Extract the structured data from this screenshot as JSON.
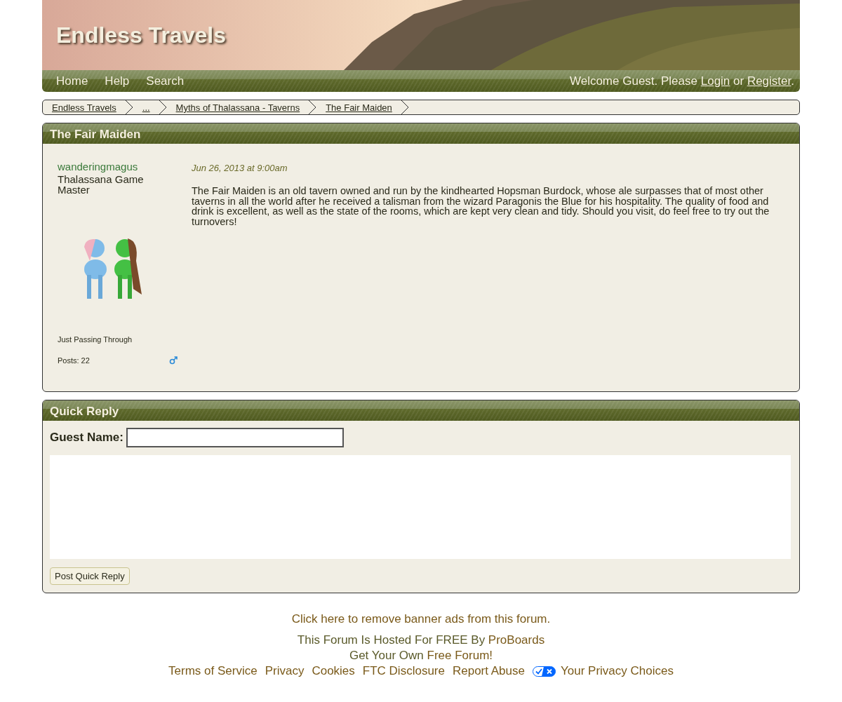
{
  "site": {
    "title": "Endless Travels"
  },
  "nav": {
    "items": [
      {
        "label": "Home"
      },
      {
        "label": "Help"
      },
      {
        "label": "Search"
      }
    ],
    "welcome": {
      "before": "Welcome Guest. Please ",
      "login": "Login",
      "middle": " or ",
      "register": "Register",
      "after": "."
    }
  },
  "breadcrumbs": [
    {
      "label": "Endless Travels"
    },
    {
      "label": "..."
    },
    {
      "label": "Myths of Thalassana - Taverns"
    },
    {
      "label": "The Fair Maiden"
    }
  ],
  "thread": {
    "title": "The Fair Maiden",
    "post": {
      "author": "wanderingmagus",
      "rank": "Thalassana Game Master",
      "status": "Just Passing Through",
      "posts": "Posts: 22",
      "male": true,
      "date": "Jun 26, 2013 at 9:00am",
      "body": "The Fair Maiden is an old tavern owned and run by the kindhearted Hopsman Burdock, whose ale surpasses that of most other taverns in all the world after he received a talisman from the wizard Paragonis the Blue for his hospitality.  The quality of food and drink is excellent, as well as the state of the rooms, which are kept very clean and tidy.  Should you visit, do feel free to try out the turnovers!"
    }
  },
  "quick_reply": {
    "title": "Quick Reply",
    "name_label": "Guest Name:",
    "button": "Post Quick Reply"
  },
  "footer": {
    "remove_ads": "Click here to remove banner ads from this forum.",
    "hosted": {
      "before": "This Forum Is Hosted For FREE By ",
      "link": "ProBoards"
    },
    "own": {
      "before": "Get Your Own ",
      "link": "Free Forum!"
    },
    "links": [
      {
        "label": "Terms of Service"
      },
      {
        "label": "Privacy"
      },
      {
        "label": "Cookies"
      },
      {
        "label": "FTC Disclosure"
      },
      {
        "label": "Report Abuse"
      },
      {
        "label": "Your Privacy Choices",
        "kind": "privacy"
      }
    ]
  }
}
